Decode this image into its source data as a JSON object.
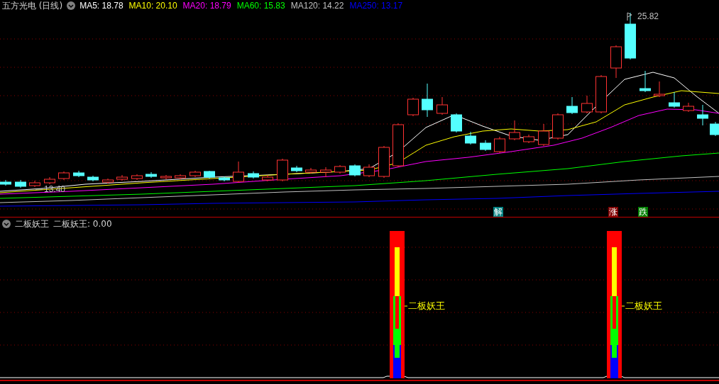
{
  "stock": {
    "name": "五方光电 (日线)",
    "ma_legend": [
      {
        "label": "MA5: 18.78",
        "color": "#ffffff"
      },
      {
        "label": "MA10: 20.10",
        "color": "#ffff00"
      },
      {
        "label": "MA20: 18.79",
        "color": "#ff00ff"
      },
      {
        "label": "MA60: 15.83",
        "color": "#00ff00"
      },
      {
        "label": "MA120: 14.22",
        "color": "#c0c0c0"
      },
      {
        "label": "MA250: 13.17",
        "color": "#0000ff"
      }
    ]
  },
  "price_chart": {
    "high_label": "25.82",
    "low_label": "13.40",
    "signals": [
      {
        "text": "解",
        "color": "#008080"
      },
      {
        "text": "涨",
        "color": "#800000"
      },
      {
        "text": "跌",
        "color": "#008000"
      }
    ]
  },
  "indicator": {
    "name": "二板妖王",
    "reading": "二板妖王: 0.00",
    "bar_labels": [
      "二板妖王",
      "二板妖王"
    ]
  }
}
